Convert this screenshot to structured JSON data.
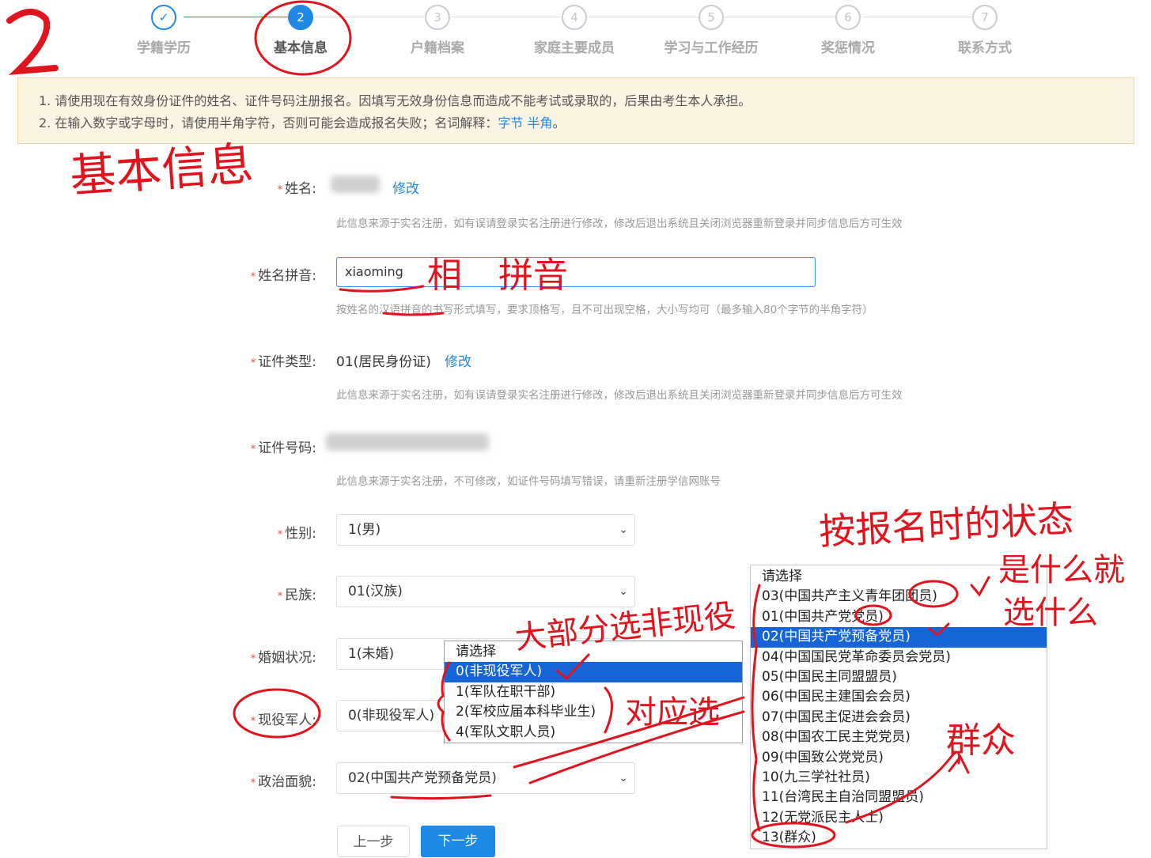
{
  "steps": [
    {
      "num": "✓",
      "label": "学籍学历"
    },
    {
      "num": "2",
      "label": "基本信息"
    },
    {
      "num": "3",
      "label": "户籍档案"
    },
    {
      "num": "4",
      "label": "家庭主要成员"
    },
    {
      "num": "5",
      "label": "学习与工作经历"
    },
    {
      "num": "6",
      "label": "奖惩情况"
    },
    {
      "num": "7",
      "label": "联系方式"
    }
  ],
  "notice": {
    "line1": "1. 请使用现在有效身份证件的姓名、证件号码注册报名。因填写无效身份信息而造成不能考试或录取的，后果由考生本人承担。",
    "line2_prefix": "2. 在输入数字或字母时，请使用半角字符，否则可能会造成报名失败；名词解释：",
    "link1": "字节",
    "link2": "半角",
    "line2_suffix": "。"
  },
  "form": {
    "name": {
      "label": "姓名:",
      "edit": "修改",
      "hint": "此信息来源于实名注册，如有误请登录实名注册进行修改，修改后退出系统且关闭浏览器重新登录并同步信息后方可生效"
    },
    "pinyin": {
      "label": "姓名拼音:",
      "value": "xiaoming",
      "hint": "按姓名的汉语拼音的书写形式填写，要求顶格写，且不可出现空格，大小写均可（最多输入80个字节的半角字符）"
    },
    "id_type": {
      "label": "证件类型:",
      "value": "01(居民身份证)",
      "edit": "修改",
      "hint": "此信息来源于实名注册，如有误请登录实名注册进行修改，修改后退出系统且关闭浏览器重新登录并同步信息后方可生效"
    },
    "id_number": {
      "label": "证件号码:",
      "hint": "此信息来源于实名注册，不可修改，如证件号码填写错误，请重新注册学信网账号"
    },
    "gender": {
      "label": "性别:",
      "value": "1(男)"
    },
    "ethnicity": {
      "label": "民族:",
      "value": "01(汉族)"
    },
    "marital": {
      "label": "婚姻状况:",
      "value": "1(未婚)"
    },
    "military": {
      "label": "现役军人:",
      "value": "0(非现役军人)"
    },
    "political": {
      "label": "政治面貌:",
      "value": "02(中国共产党预备党员)"
    }
  },
  "military_options": [
    "请选择",
    "0(非现役军人)",
    "1(军队在职干部)",
    "2(军校应届本科毕业生)",
    "4(军队文职人员)"
  ],
  "political_options": [
    "请选择",
    "03(中国共产主义青年团团员)",
    "01(中国共产党党员)",
    "02(中国共产党预备党员)",
    "04(中国国民党革命委员会党员)",
    "05(中国民主同盟盟员)",
    "06(中国民主建国会会员)",
    "07(中国民主促进会会员)",
    "08(中国农工民主党党员)",
    "09(中国致公党党员)",
    "10(九三学社社员)",
    "11(台湾民主自治同盟盟员)",
    "12(无党派民主人士)",
    "13(群众)"
  ],
  "buttons": {
    "prev": "上一步",
    "next": "下一步"
  },
  "annotations": {
    "step_number": "2",
    "section_title": "基本信息",
    "pinyin_note": "拼音",
    "pinyin_note_prefix": "相",
    "status_note_1": "按报名时的状态",
    "status_note_2": "是什么就",
    "status_note_3": "选什么",
    "military_note": "大部分选非现役",
    "match_note": "对应选",
    "masses_note": "群众"
  },
  "colors": {
    "accent": "#1e88e5",
    "annotation": "#e0141e",
    "notice_bg": "#fcf4e3"
  }
}
